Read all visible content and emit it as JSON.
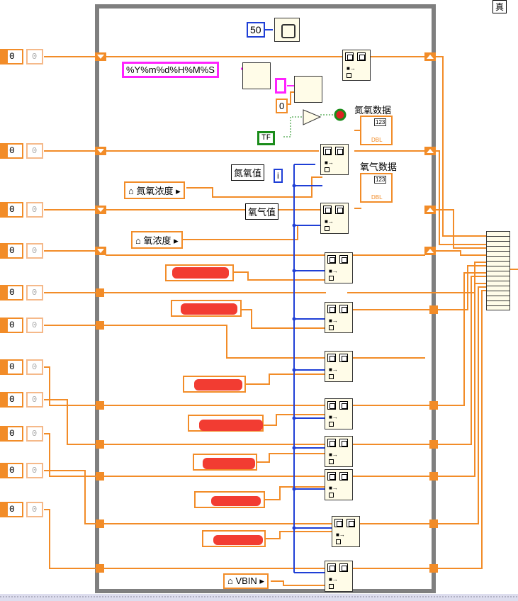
{
  "corner_label": "真",
  "loop": {
    "wait_ms": "50",
    "wait_icon": "wait-ms-icon",
    "iteration_label": "i"
  },
  "format_string": "%Y%m%d%H%M%S",
  "format_const_zero": "0",
  "bool_const": "TF",
  "controls_value": "0",
  "indicators": [
    {
      "caption": "氮氧数据",
      "type_tag": "123",
      "dbl_tag": "DBL"
    },
    {
      "caption": "氧气数据",
      "type_tag": "123",
      "dbl_tag": "DBL"
    }
  ],
  "value_labels": {
    "nox_value": "氮氧值",
    "o2_value": "氧气值"
  },
  "property_nodes": {
    "nox_conc": "氮氧浓度",
    "o2_conc": "氧浓度",
    "vbin": "VBIN"
  },
  "colors": {
    "wire_orange": "#f28c28",
    "wire_blue": "#1f3fd6",
    "loop_border": "#7f7f7f",
    "redaction": "#f23c32",
    "string_pink": "#ff22ff",
    "bool_green": "#1a8c1a"
  }
}
